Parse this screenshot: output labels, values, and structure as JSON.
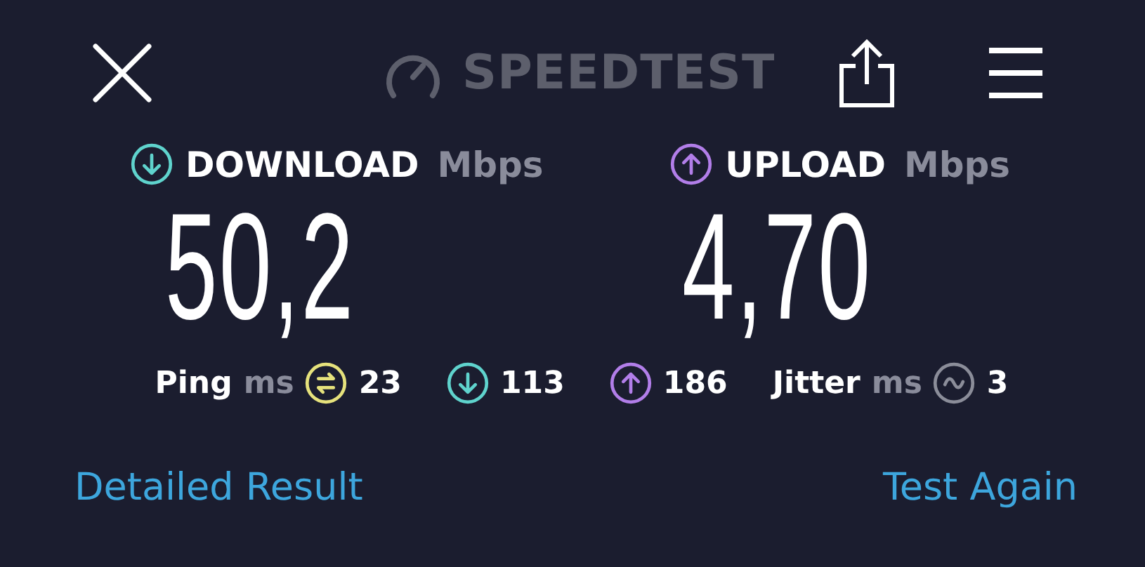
{
  "header": {
    "logo": "SPEEDTEST"
  },
  "metrics": [
    {
      "kind": "download",
      "label": "DOWNLOAD",
      "unit": "Mbps",
      "value": "50,2",
      "color": "#5fd3cd"
    },
    {
      "kind": "upload",
      "label": "UPLOAD",
      "unit": "Mbps",
      "value": "4,70",
      "color": "#b27ee9"
    }
  ],
  "stats": [
    {
      "kind": "ping",
      "label": "Ping",
      "unit": "ms",
      "value": "23",
      "color": "#e6e27c"
    },
    {
      "kind": "download",
      "value": "113",
      "color": "#5fd3cd"
    },
    {
      "kind": "upload",
      "value": "186",
      "color": "#b27ee9"
    },
    {
      "kind": "jitter",
      "label": "Jitter",
      "unit": "ms",
      "value": "3",
      "color": "#8b8d99"
    }
  ],
  "links": [
    "Detailed Result",
    "Test Again"
  ]
}
